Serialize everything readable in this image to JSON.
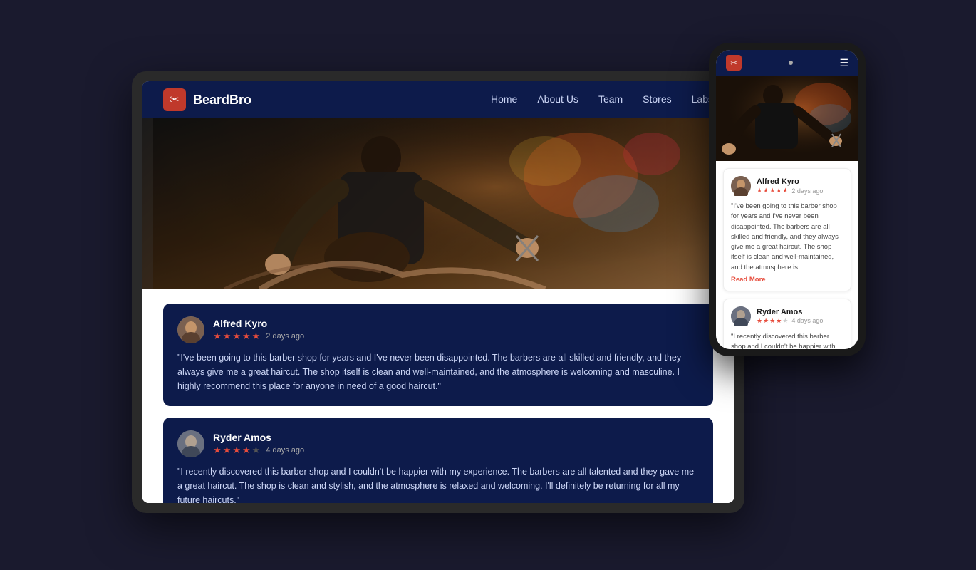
{
  "app": {
    "name": "BeardBro",
    "logo_icon": "✂",
    "accent_color": "#c0392b",
    "nav_bg": "#0d1b4b"
  },
  "tablet": {
    "nav": {
      "logo": "BeardBro",
      "links": [
        {
          "label": "Home",
          "id": "home"
        },
        {
          "label": "About Us",
          "id": "about"
        },
        {
          "label": "Team",
          "id": "team"
        },
        {
          "label": "Stores",
          "id": "stores"
        },
        {
          "label": "Labs",
          "id": "labs"
        }
      ]
    },
    "reviews": [
      {
        "name": "Alfred Kyro",
        "date": "2 days ago",
        "stars": 5,
        "text": "\"I've been going to this barber shop for years and I've never been disappointed. The barbers are all skilled and friendly, and they always give me a great haircut. The shop itself is clean and well-maintained, and the atmosphere is welcoming and masculine. I highly recommend this place for anyone in need of a good haircut.\""
      },
      {
        "name": "Ryder Amos",
        "date": "4 days ago",
        "stars": 4,
        "text": "\"I recently discovered this barber shop and I couldn't be happier with my experience. The barbers are all talented and they gave me a great haircut. The shop is clean and stylish, and the atmosphere is relaxed and welcoming. I'll definitely be returning for all my future haircuts.\""
      }
    ]
  },
  "phone": {
    "reviews": [
      {
        "name": "Alfred Kyro",
        "date": "2 days ago",
        "stars": 5,
        "text": "\"I've been going to this barber shop for years and I've never been disappointed. The barbers are all skilled and friendly, and they always give me a great haircut. The shop itself is clean and well-maintained, and the atmosphere is...",
        "read_more": "Read More"
      },
      {
        "name": "Ryder Amos",
        "date": "4 days ago",
        "stars": 4,
        "text": "\"I recently discovered this barber shop and I couldn't be happier with my experience. The barbers are all talented and they gave me a great haircut. The shop is clean and stylish, and the atmosphere is relaxed and welcoming. I'll definitely be returning for all my future"
      }
    ]
  }
}
